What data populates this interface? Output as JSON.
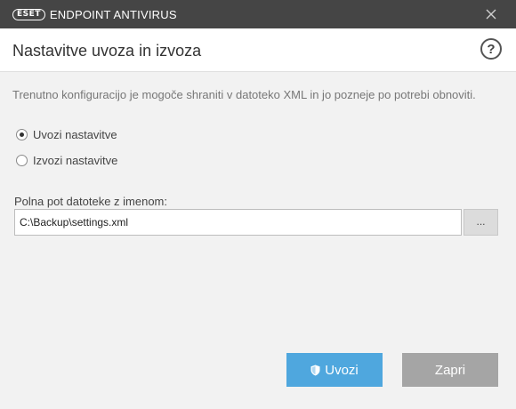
{
  "window": {
    "brand": "ESET",
    "product": "ENDPOINT ANTIVIRUS",
    "close_icon": "close-icon"
  },
  "header": {
    "title": "Nastavitve uvoza in izvoza",
    "help_label": "?"
  },
  "main": {
    "description": "Trenutno konfiguracijo je mogoče shraniti v datoteko XML in jo pozneje po potrebi obnoviti.",
    "options": [
      {
        "label": "Uvozi nastavitve",
        "selected": true
      },
      {
        "label": "Izvozi nastavitve",
        "selected": false
      }
    ],
    "path_label": "Polna pot datoteke z imenom:",
    "path_value": "C:\\Backup\\settings.xml",
    "browse_label": "..."
  },
  "footer": {
    "primary_label": "Uvozi",
    "primary_icon": "shield-icon",
    "secondary_label": "Zapri"
  },
  "colors": {
    "titlebar": "#454545",
    "primary": "#4fa7de",
    "secondary": "#a5a5a5"
  }
}
